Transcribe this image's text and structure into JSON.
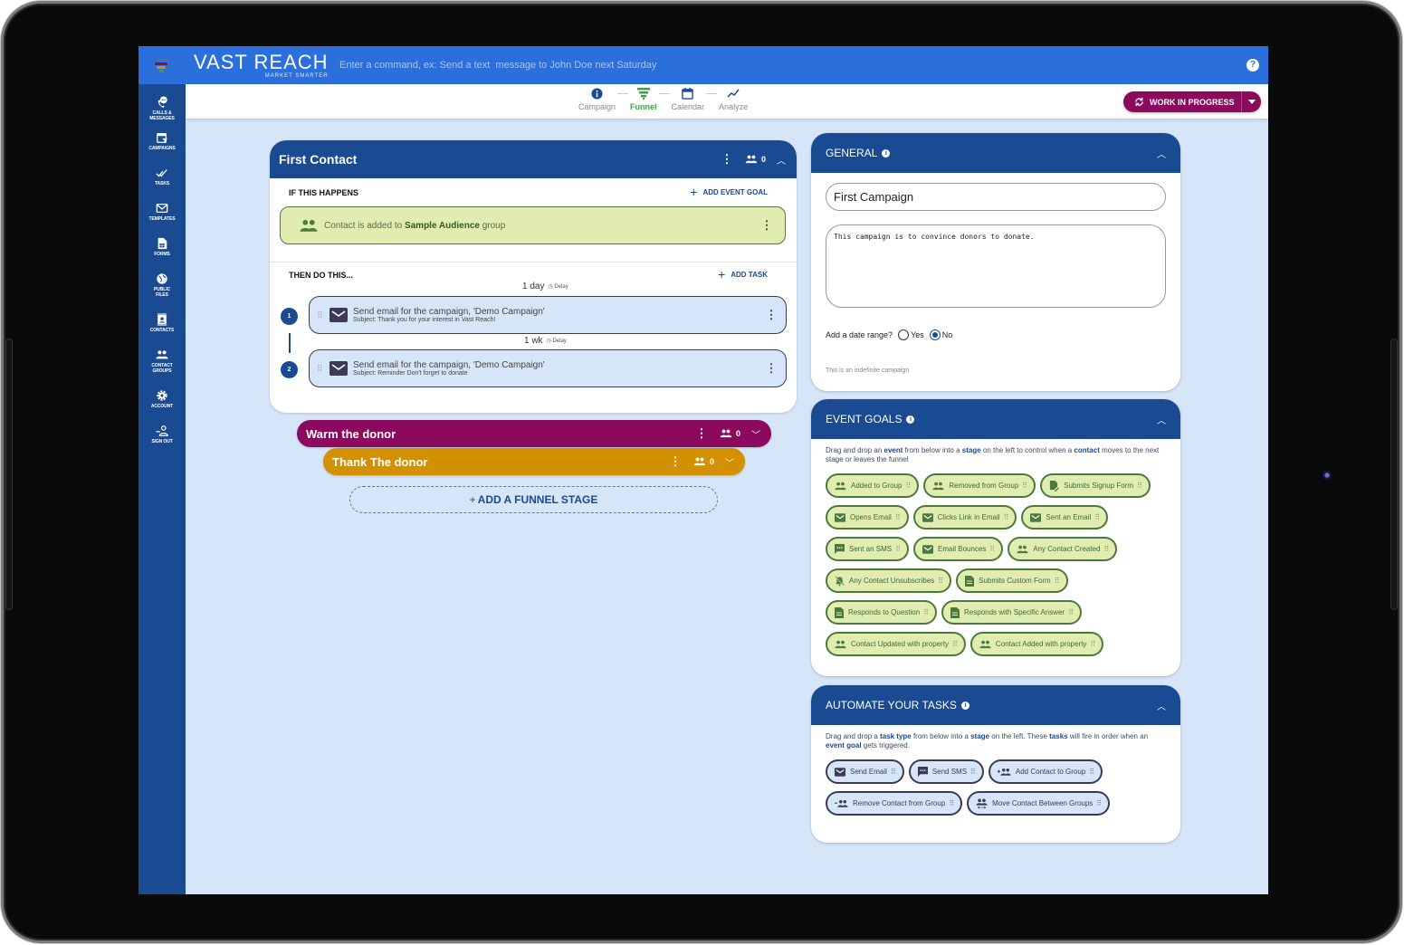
{
  "colors": {
    "topbar": "#2a6fdb",
    "primary": "#1a4a92",
    "stage_warm": "#8c0a5e",
    "stage_thank": "#d39000",
    "event_green": "#e1ecb1",
    "task_blue": "#d6e5f8",
    "active_step": "#3aa53a"
  },
  "topbar": {
    "brand_name": "VAST REACH",
    "brand_tagline": "MARKET SMARTER",
    "command_placeholder": "Enter a command, ex: Send a text  message to John Doe next Saturday",
    "help_icon": "?"
  },
  "sidebar": {
    "items": [
      {
        "label": "CALLS &",
        "label2": "MESSAGES",
        "icon": "chat-phone-icon"
      },
      {
        "label": "CAMPAIGNS",
        "label2": "",
        "icon": "calendar-funnel-icon"
      },
      {
        "label": "TASKS",
        "label2": "",
        "icon": "double-check-icon"
      },
      {
        "label": "TEMPLATES",
        "label2": "",
        "icon": "envelope-icon"
      },
      {
        "label": "FORMS",
        "label2": "",
        "icon": "form-icon"
      },
      {
        "label": "PUBLIC",
        "label2": "FILES",
        "icon": "globe-icon"
      },
      {
        "label": "CONTACTS",
        "label2": "",
        "icon": "contact-card-icon"
      },
      {
        "label": "CONTACT",
        "label2": "GROUPS",
        "icon": "group-icon"
      },
      {
        "label": "ACCOUNT",
        "label2": "",
        "icon": "gear-icon"
      },
      {
        "label": "SIGN OUT",
        "label2": "",
        "icon": "sign-out-icon"
      }
    ]
  },
  "steps": [
    {
      "label": "Campaign",
      "icon": "info-icon",
      "active": false
    },
    {
      "label": "Funnel",
      "icon": "funnel-icon",
      "active": true
    },
    {
      "label": "Calendar",
      "icon": "calendar-icon",
      "active": false
    },
    {
      "label": "Analyze",
      "icon": "trend-icon",
      "active": false
    }
  ],
  "status_button": {
    "label": "WORK IN PROGRESS"
  },
  "funnel": {
    "stages": [
      {
        "title": "First Contact",
        "count": "0",
        "expanded": true,
        "if_label": "IF THIS HAPPENS",
        "add_event_goal": "ADD EVENT GOAL",
        "event": {
          "prefix": "Contact is added to ",
          "group": "Sample Audience",
          "suffix": " group"
        },
        "then_label": "THEN DO THIS...",
        "add_task": "ADD TASK",
        "tasks": [
          {
            "number": "1",
            "delay": "1 day",
            "delay_label": "Delay",
            "title": "Send email for the campaign, 'Demo Campaign'",
            "subject": "Subject: Thank you for your interest in Vast Reach!"
          },
          {
            "number": "2",
            "delay": "1 wk",
            "delay_label": "Delay",
            "title": "Send email for the campaign, 'Demo Campaign'",
            "subject": "Subject: Reminder Don't forget to donate"
          }
        ]
      },
      {
        "title": "Warm the donor",
        "count": "0",
        "expanded": false
      },
      {
        "title": "Thank The donor",
        "count": "0",
        "expanded": false
      }
    ],
    "add_stage": "ADD A FUNNEL STAGE"
  },
  "general": {
    "title": "GENERAL",
    "campaign_name": "First Campaign",
    "description": "This campaign is to convince donors to donate.",
    "date_range_label": "Add a date range?",
    "yes_label": "Yes",
    "no_label": "No",
    "date_range_selected": "No",
    "note": "This is an indefinite campaign"
  },
  "event_goals": {
    "title": "EVENT GOALS",
    "desc_parts": [
      "Drag and drop an ",
      "event",
      " from below into a ",
      "stage",
      " on the left to control when a ",
      "contact",
      " moves to the next stage or leaves the funnel"
    ],
    "items": [
      {
        "label": "Added to Group",
        "icon": "group-icon"
      },
      {
        "label": "Removed from Group",
        "icon": "group-icon"
      },
      {
        "label": "Submits Signup Form",
        "icon": "signup-form-icon"
      },
      {
        "label": "Opens Email",
        "icon": "envelope-icon"
      },
      {
        "label": "Clicks Link in Email",
        "icon": "envelope-icon"
      },
      {
        "label": "Sent an Email",
        "icon": "envelope-icon"
      },
      {
        "label": "Sent an SMS",
        "icon": "sms-icon"
      },
      {
        "label": "Email Bounces",
        "icon": "envelope-icon"
      },
      {
        "label": "Any Contact Created",
        "icon": "group-icon"
      },
      {
        "label": "Any Contact Unsubscribes",
        "icon": "bell-off-icon"
      },
      {
        "label": "Submits Custom Form",
        "icon": "document-icon"
      },
      {
        "label": "Responds to Question",
        "icon": "document-icon"
      },
      {
        "label": "Responds with Specific Answer",
        "icon": "document-icon"
      },
      {
        "label": "Contact Updated with property",
        "icon": "group-icon"
      },
      {
        "label": "Contact Added with property",
        "icon": "group-icon"
      }
    ]
  },
  "automate": {
    "title": "AUTOMATE YOUR TASKS",
    "desc_parts": [
      "Drag and drop a ",
      "task type",
      " from below into a ",
      "stage",
      " on the left. These ",
      "tasks",
      " will fire in order when an ",
      "event goal",
      " gets triggered."
    ],
    "items": [
      {
        "label": "Send Email",
        "icon": "envelope-icon"
      },
      {
        "label": "Send SMS",
        "icon": "sms-icon"
      },
      {
        "label": "Add Contact to Group",
        "icon": "group-add-icon"
      },
      {
        "label": "Remove Contact from Group",
        "icon": "group-remove-icon"
      },
      {
        "label": "Move Contact Between Groups",
        "icon": "group-move-icon"
      }
    ]
  }
}
